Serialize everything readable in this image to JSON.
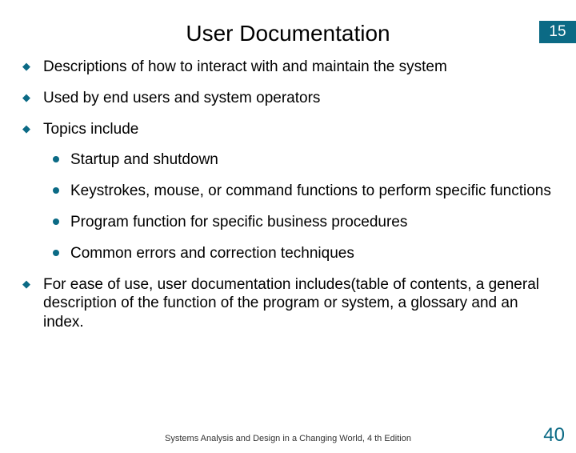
{
  "chapter_number": "15",
  "title": "User Documentation",
  "bullets": [
    {
      "text": "Descriptions of how to interact with and maintain the system"
    },
    {
      "text": "Used by end users and system operators"
    },
    {
      "text": "Topics include",
      "sub": [
        "Startup and shutdown",
        "Keystrokes, mouse, or command functions to perform specific functions",
        "Program function for specific business procedures",
        "Common errors and correction techniques"
      ]
    },
    {
      "text": "For ease of use, user documentation includes(table of contents, a general description of the function of the program or system, a glossary and an index."
    }
  ],
  "footer": "Systems Analysis and Design in a Changing World, 4 th Edition",
  "page_number": "40"
}
